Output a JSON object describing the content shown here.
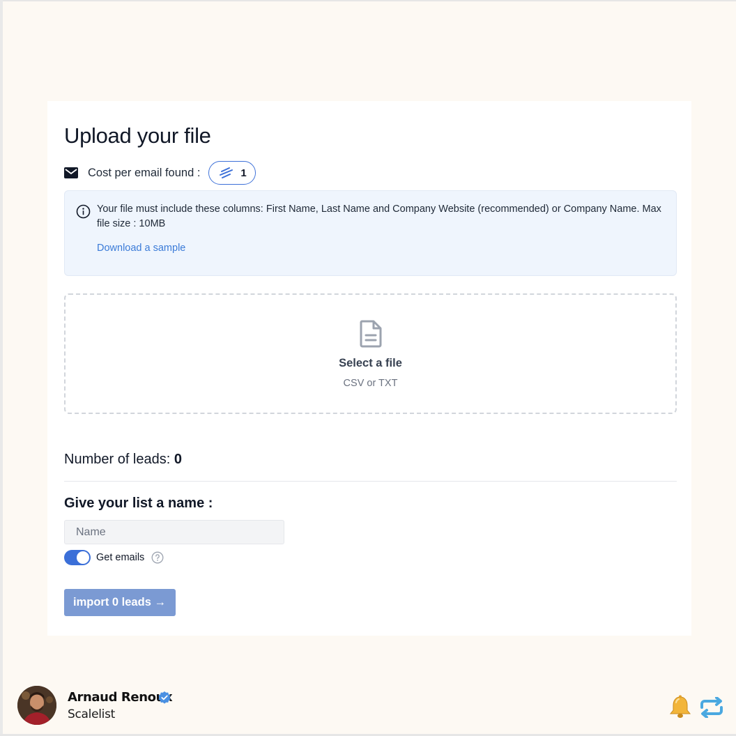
{
  "page": {
    "title": "Upload your file",
    "cost_label": "Cost per email found :",
    "cost_value": "1",
    "info": {
      "text": "Your file must include these columns: First Name, Last Name and Company Website (recommended) or Company Name. Max file size : 10MB",
      "link": "Download a sample"
    },
    "dropzone": {
      "title": "Select a file",
      "subtitle": "CSV or TXT"
    },
    "leads": {
      "label": "Number of leads:",
      "count": "0"
    },
    "list_name": {
      "heading": "Give your list a name :",
      "placeholder": "Name",
      "value": ""
    },
    "get_emails": {
      "label": "Get emails",
      "enabled": true
    },
    "import_button": "import 0 leads →"
  },
  "author": {
    "name": "Arnaud Renoux",
    "company": "Scalelist"
  },
  "colors": {
    "accent": "#3b6fd8",
    "link": "#3b7bd8",
    "info_bg": "#eff5fd",
    "button_disabled": "#7b9ad3",
    "page_bg": "#fdf9f3"
  },
  "icons": [
    "mail-icon",
    "credit-bolt-icon",
    "info-icon",
    "file-icon",
    "help-icon",
    "verified-badge-icon",
    "bell-icon",
    "repost-icon"
  ]
}
